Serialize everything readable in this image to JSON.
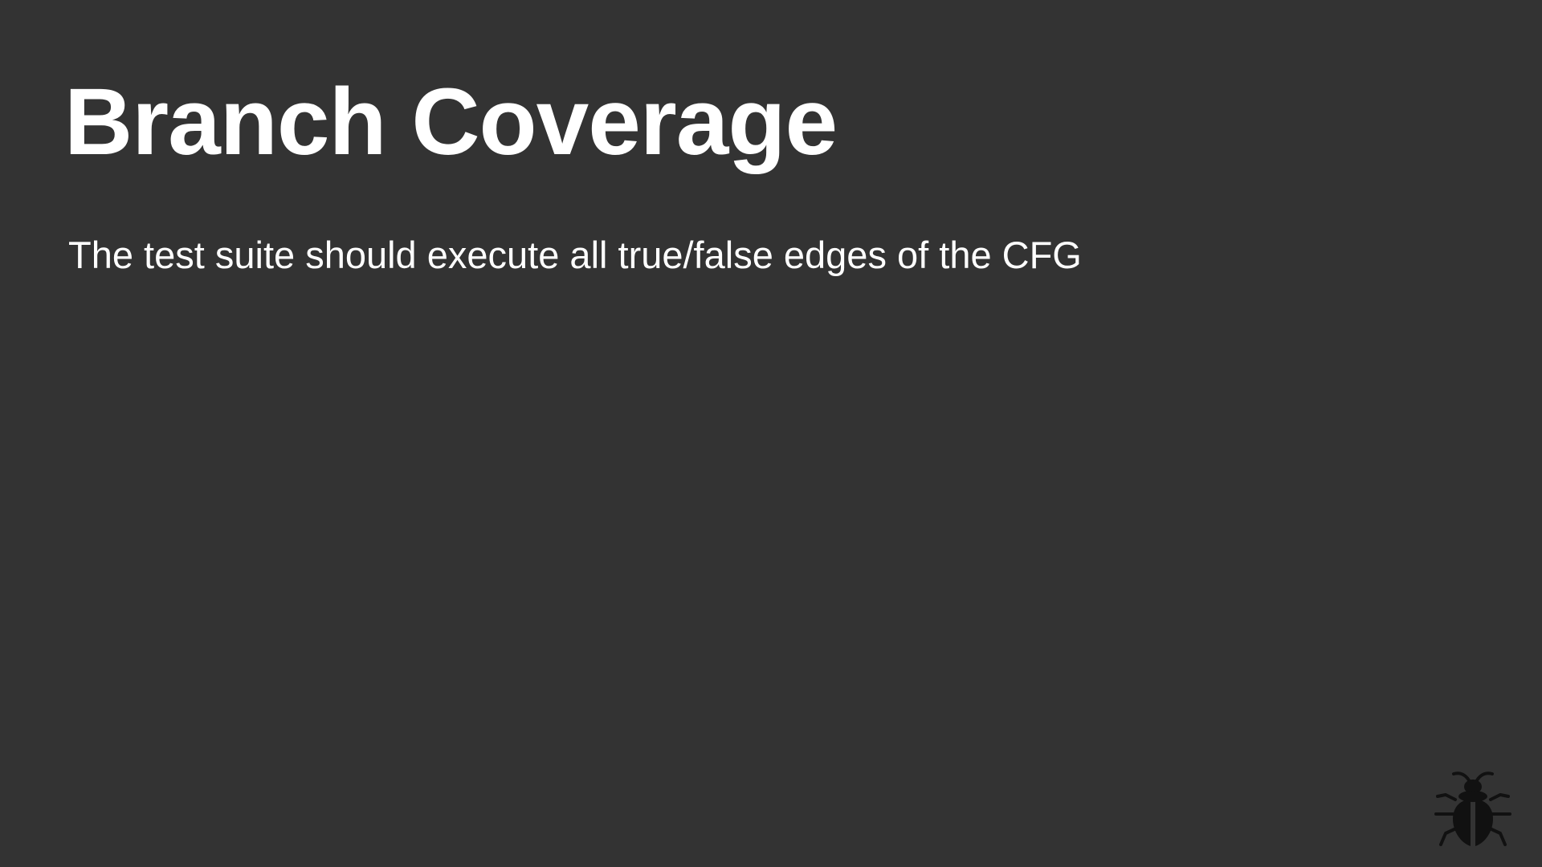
{
  "slide": {
    "title": "Branch Coverage",
    "body_text": "The test suite should execute all true/false edges of the CFG",
    "logo_icon": "bug-icon",
    "colors": {
      "background": "#333333",
      "text": "#ffffff",
      "logo": "#111111"
    }
  }
}
